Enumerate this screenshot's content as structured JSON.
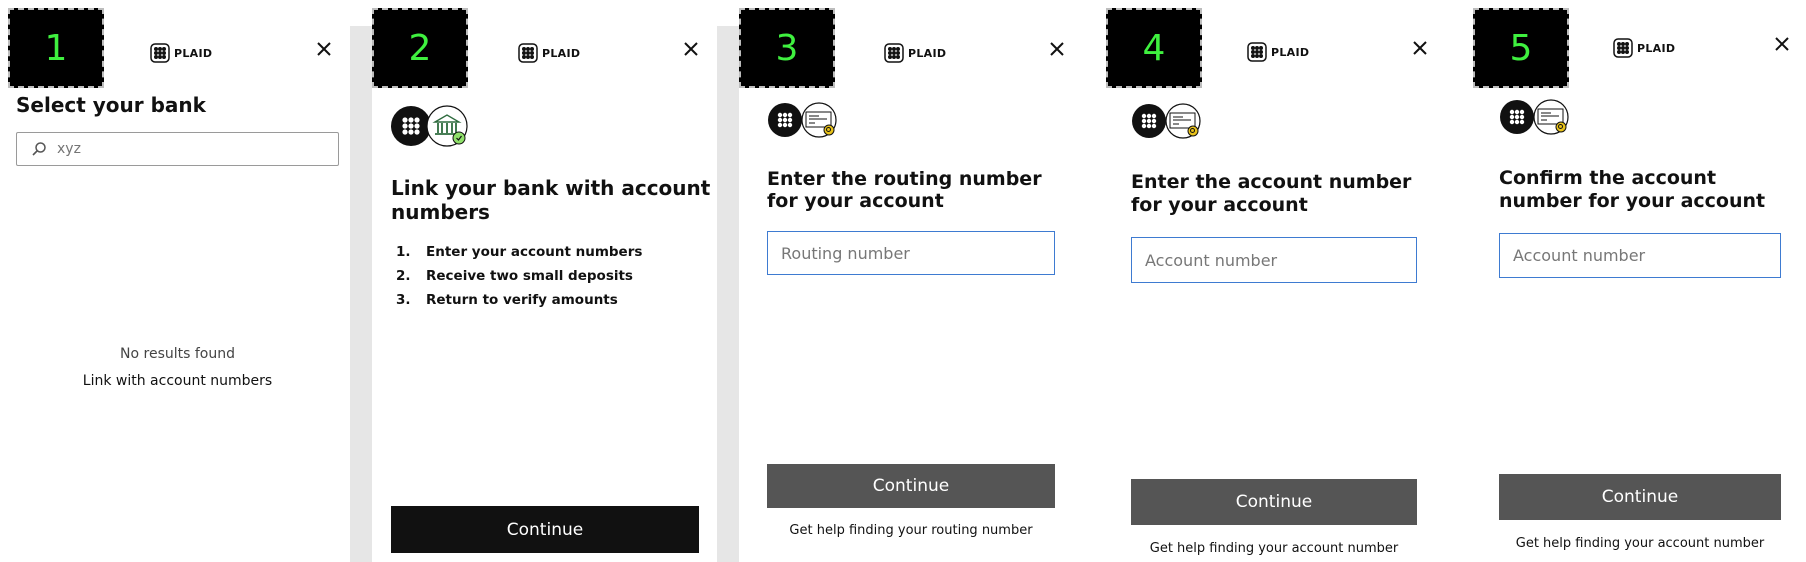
{
  "brand": {
    "logo_text": "PLAID"
  },
  "screens": [
    {
      "step": "1",
      "title": "Select your bank",
      "search": {
        "value": "",
        "placeholder": "xyz"
      },
      "empty_text": "No results found",
      "link_text": "Link with account numbers"
    },
    {
      "step": "2",
      "title": "Link your bank with account numbers",
      "steps": [
        {
          "num": "1.",
          "text": "Enter your account numbers"
        },
        {
          "num": "2.",
          "text": "Receive two small deposits"
        },
        {
          "num": "3.",
          "text": "Return to verify amounts"
        }
      ],
      "button": "Continue"
    },
    {
      "step": "3",
      "title": "Enter the routing number for your account",
      "input_placeholder": "Routing number",
      "button": "Continue",
      "help": "Get help finding your routing number"
    },
    {
      "step": "4",
      "title": "Enter the account number for your account",
      "input_placeholder": "Account number",
      "button": "Continue",
      "help": "Get help finding your account number"
    },
    {
      "step": "5",
      "title": "Confirm the account number for your account",
      "input_placeholder": "Account number",
      "button": "Continue",
      "help": "Get help finding your account number"
    }
  ],
  "colors": {
    "badge_bg": "#000000",
    "badge_text": "#3ff03f",
    "input_border": "#3e7bd1",
    "button_dark": "#111111",
    "button_gray": "#555555",
    "gutter": "#e6e6e6",
    "bank_icon_accent": "#2e8b57",
    "search_icon_accent": "#e8c21a"
  },
  "icons": {
    "logo": "plaid-logo-icon",
    "close": "close-icon",
    "search": "search-icon",
    "bank": "bank-icon",
    "check": "check-card-icon"
  }
}
